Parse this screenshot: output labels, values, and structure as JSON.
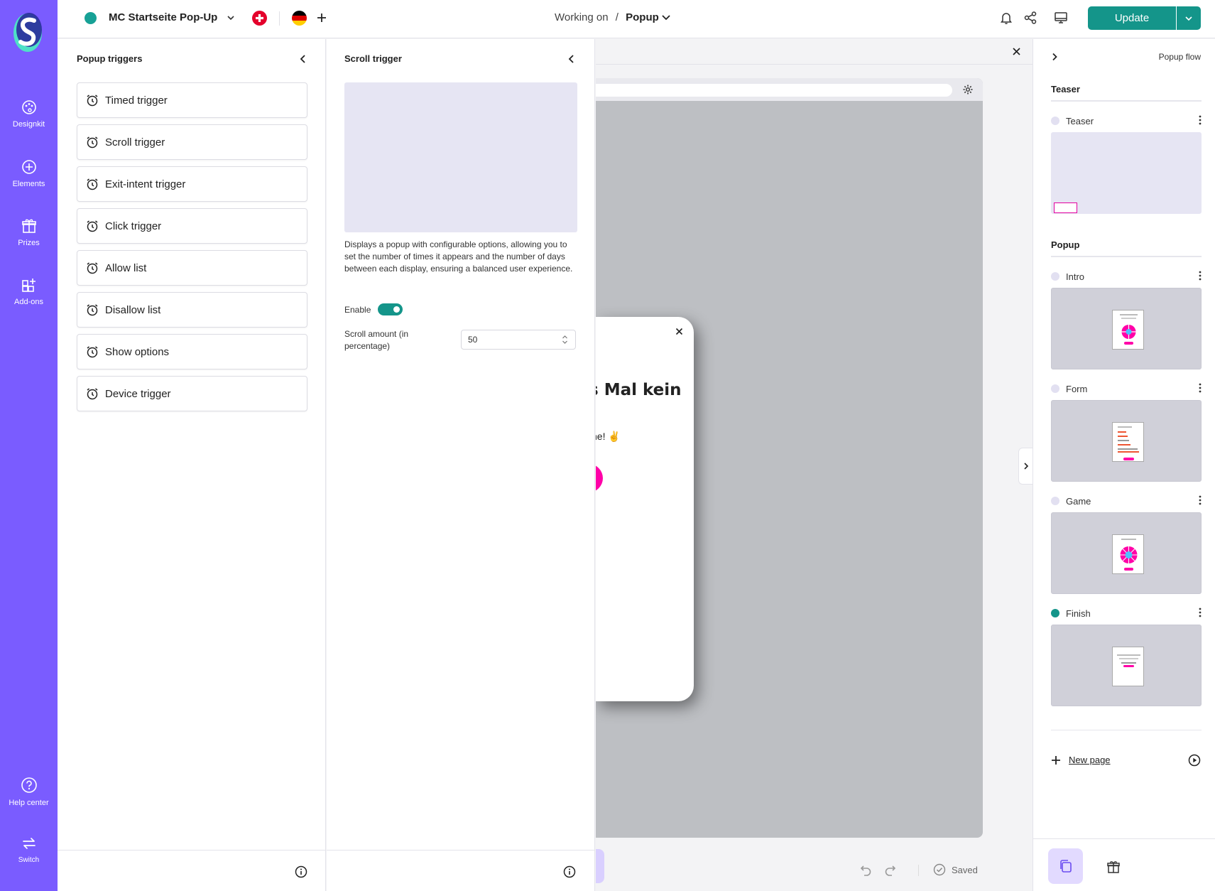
{
  "app": {
    "project_name": "MC Startseite Pop-Up",
    "breadcrumb_prefix": "Working on",
    "breadcrumb_separator": "/",
    "breadcrumb_current": "Popup",
    "update_label": "Update"
  },
  "rail": {
    "items": [
      {
        "label": "Designkit",
        "icon": "palette-icon"
      },
      {
        "label": "Elements",
        "icon": "plus-circle-icon"
      },
      {
        "label": "Prizes",
        "icon": "gift-icon"
      },
      {
        "label": "Add-ons",
        "icon": "add-ons-icon"
      }
    ],
    "help_label": "Help center",
    "switch_label": "Switch"
  },
  "triggers_panel": {
    "title": "Popup triggers",
    "items": [
      "Timed trigger",
      "Scroll trigger",
      "Exit-intent trigger",
      "Click trigger",
      "Allow list",
      "Disallow list",
      "Show options",
      "Device trigger"
    ]
  },
  "scroll_panel": {
    "title": "Scroll trigger",
    "description": "Displays a popup with configurable options, allowing you to set the number of times it appears and the number of days between each display, ensuring a balanced user experience.",
    "enable_label": "Enable",
    "enabled": true,
    "scroll_amount_label": "Scroll amount (in percentage)",
    "scroll_amount_value": "50"
  },
  "canvas": {
    "popup_heading_fragment": "s Mal kein",
    "popup_text_fragment": "ne! ✌️",
    "status_saved": "Saved"
  },
  "flow": {
    "title": "Popup flow",
    "teaser_section": "Teaser",
    "popup_section": "Popup",
    "teaser_page": "Teaser",
    "pages": [
      "Intro",
      "Form",
      "Game",
      "Finish"
    ],
    "active_page": "Finish",
    "new_page_label": "New page"
  },
  "colors": {
    "rail": "#7a5cff",
    "accent": "#14958a",
    "popup_button": "#ff00a8"
  }
}
